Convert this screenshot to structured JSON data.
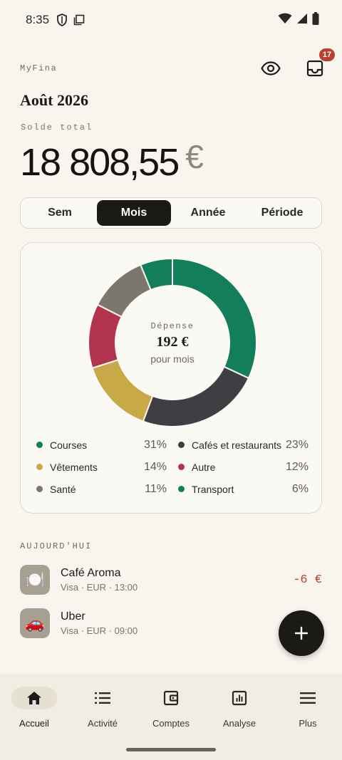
{
  "status_bar": {
    "time": "8:35"
  },
  "header": {
    "app_name": "MyFina",
    "notifications_count": "17"
  },
  "summary": {
    "month": "Août 2026",
    "balance_label": "Solde total",
    "balance_amount": "18 808,55",
    "balance_currency": "€"
  },
  "period_tabs": [
    {
      "label": "Sem"
    },
    {
      "label": "Mois",
      "active": true
    },
    {
      "label": "Année"
    },
    {
      "label": "Période"
    }
  ],
  "chart_data": {
    "type": "pie",
    "center_label": "Dépense",
    "center_value": "192 €",
    "center_sub": "pour mois",
    "slices": [
      {
        "name": "Courses",
        "pct_label": "31%",
        "value": 31,
        "color": "#127e5c"
      },
      {
        "name": "Cafés et restaurants",
        "pct_label": "23%",
        "value": 23,
        "color": "#3f3e42"
      },
      {
        "name": "Vêtements",
        "pct_label": "14%",
        "value": 14,
        "color": "#c8a947"
      },
      {
        "name": "Autre",
        "pct_label": "12%",
        "value": 12,
        "color": "#b3344e"
      },
      {
        "name": "Santé",
        "pct_label": "11%",
        "value": 11,
        "color": "#7b766e"
      },
      {
        "name": "Transport",
        "pct_label": "6%",
        "value": 6,
        "color": "#127e5c"
      }
    ]
  },
  "today": {
    "label": "AUJOURD'HUI",
    "transactions": [
      {
        "name": "Café Aroma",
        "meta": "Visa · EUR · 13:00",
        "amount": "-6 €",
        "icon": "🍽️"
      },
      {
        "name": "Uber",
        "meta": "Visa · EUR · 09:00",
        "amount": "",
        "icon": "🚗"
      }
    ]
  },
  "bottom_nav": [
    {
      "label": "Accueil",
      "icon": "home-icon",
      "active": true
    },
    {
      "label": "Activité",
      "icon": "list-icon"
    },
    {
      "label": "Comptes",
      "icon": "wallet-icon"
    },
    {
      "label": "Analyse",
      "icon": "chart-icon"
    },
    {
      "label": "Plus",
      "icon": "menu-icon"
    }
  ]
}
